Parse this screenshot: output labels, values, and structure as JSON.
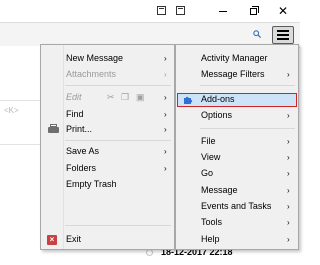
{
  "colors": {
    "highlight_border": "#d02424",
    "highlight_fill": "#cde3f7",
    "menu_bg": "#f0f0f0",
    "addons_icon": "#2f6fd6",
    "exit_icon": "#c94141"
  },
  "titlebar": {
    "icons": [
      "calendar-icon",
      "tasks-icon"
    ],
    "window_controls": [
      "minimize",
      "maximize",
      "close"
    ]
  },
  "toolbar": {
    "search_icon": "search-icon",
    "menu_button_icon": "hamburger-icon"
  },
  "search_hint": "<K>",
  "main_menu": {
    "left": {
      "new_message": "New Message",
      "attachments": "Attachments",
      "edit": "Edit",
      "find": "Find",
      "print": "Print...",
      "save_as": "Save As",
      "folders": "Folders",
      "empty_trash": "Empty Trash",
      "exit": "Exit"
    },
    "right": {
      "activity_manager": "Activity Manager",
      "message_filters": "Message Filters",
      "addons": "Add-ons",
      "options": "Options",
      "file": "File",
      "view": "View",
      "go": "Go",
      "message": "Message",
      "events_and_tasks": "Events and Tasks",
      "tools": "Tools",
      "help": "Help"
    },
    "submenu_arrow": "›"
  },
  "message_list": {
    "date": "18-12-2017 22:18"
  }
}
